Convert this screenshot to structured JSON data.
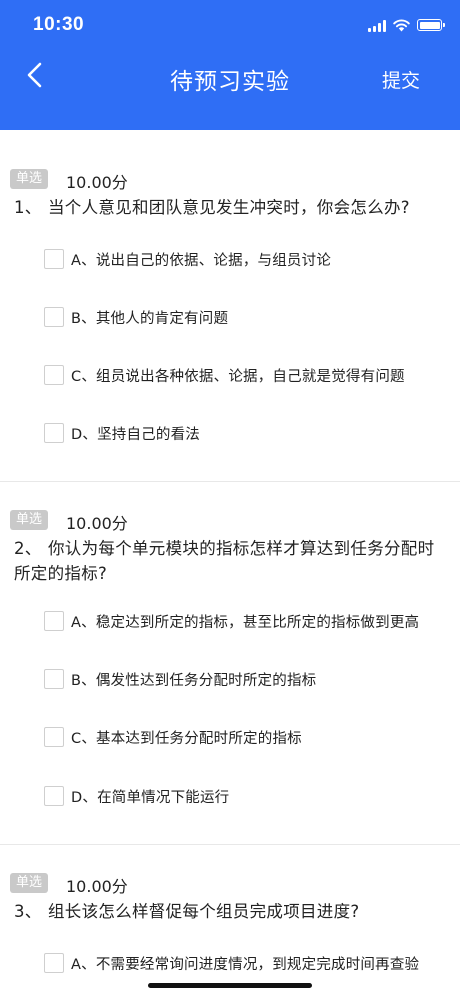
{
  "status": {
    "time": "10:30"
  },
  "header": {
    "title": "待预习实验",
    "submit": "提交"
  },
  "questions": [
    {
      "tag": "单选",
      "score": "10.00分",
      "number": "1、",
      "text": "当个人意见和团队意见发生冲突时，你会怎么办?",
      "options": [
        "A、说出自己的依据、论据，与组员讨论",
        "B、其他人的肯定有问题",
        "C、组员说出各种依据、论据，自己就是觉得有问题",
        "D、坚持自己的看法"
      ]
    },
    {
      "tag": "单选",
      "score": "10.00分",
      "number": "2、",
      "text": "你认为每个单元模块的指标怎样才算达到任务分配时所定的指标?",
      "options": [
        "A、稳定达到所定的指标，甚至比所定的指标做到更高",
        "B、偶发性达到任务分配时所定的指标",
        "C、基本达到任务分配时所定的指标",
        "D、在简单情况下能运行"
      ]
    },
    {
      "tag": "单选",
      "score": "10.00分",
      "number": "3、",
      "text": "组长该怎么样督促每个组员完成项目进度?",
      "options": [
        "A、不需要经常询问进度情况，到规定完成时间再查验"
      ]
    }
  ],
  "colors": {
    "header_bg": "#2f6ef5",
    "tag_bg": "#c9c9c9"
  }
}
